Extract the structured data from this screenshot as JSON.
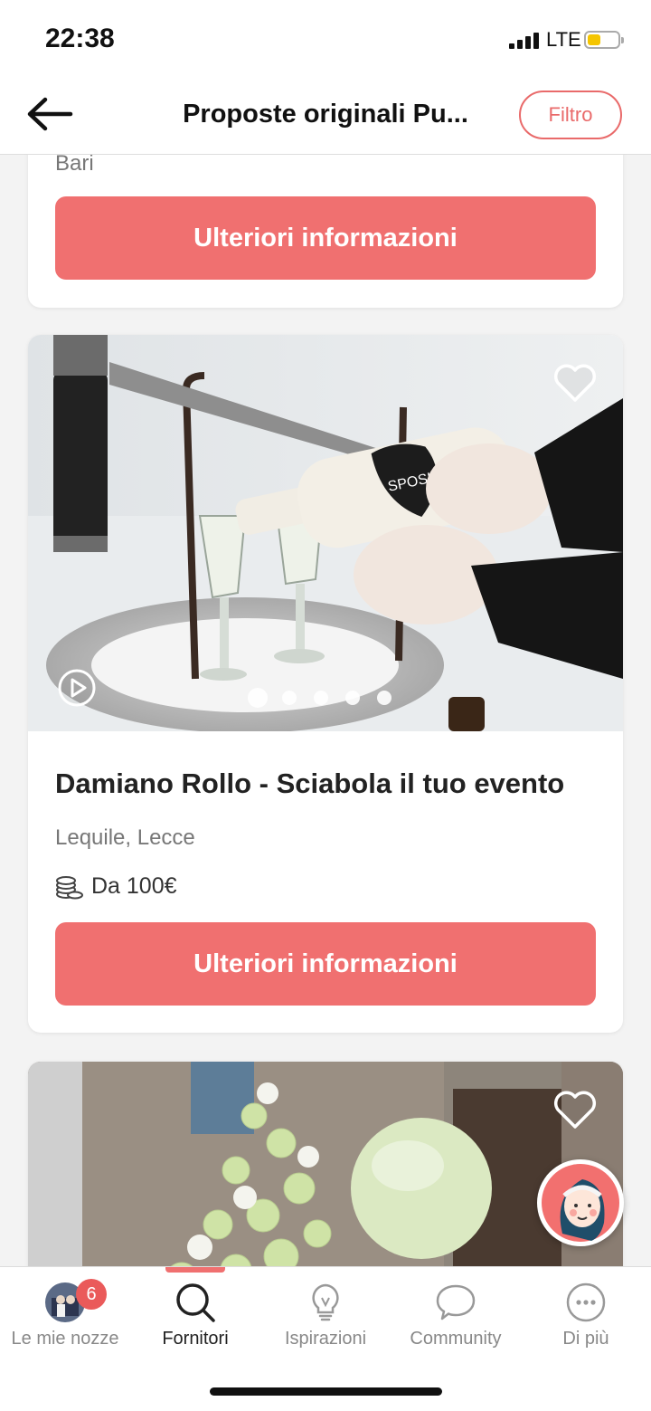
{
  "status_bar": {
    "time": "22:38",
    "network": "LTE"
  },
  "header": {
    "title": "Proposte originali Pu...",
    "filter_label": "Filtro"
  },
  "cards": [
    {
      "location": "Bari",
      "button_label": "Ulteriori informazioni"
    },
    {
      "title": "Damiano Rollo - Sciabola il tuo evento",
      "location": "Lequile, Lecce",
      "price": "Da 100€",
      "button_label": "Ulteriori informazioni",
      "bottle_text": "SPOSI",
      "carousel": {
        "total": 5,
        "active": 1
      }
    },
    {
      "title": "",
      "carousel": {
        "total": 1,
        "active": 1
      }
    }
  ],
  "tabbar": {
    "items": [
      {
        "label": "Le mie nozze",
        "badge": "6",
        "icon": "avatar-icon"
      },
      {
        "label": "Fornitori",
        "icon": "search-icon"
      },
      {
        "label": "Ispirazioni",
        "icon": "lightbulb-icon"
      },
      {
        "label": "Community",
        "icon": "chat-bubble-icon"
      },
      {
        "label": "Di più",
        "icon": "more-icon"
      }
    ],
    "active_index": 1
  },
  "colors": {
    "accent": "#f07070",
    "text": "#222222",
    "muted": "#777777"
  }
}
